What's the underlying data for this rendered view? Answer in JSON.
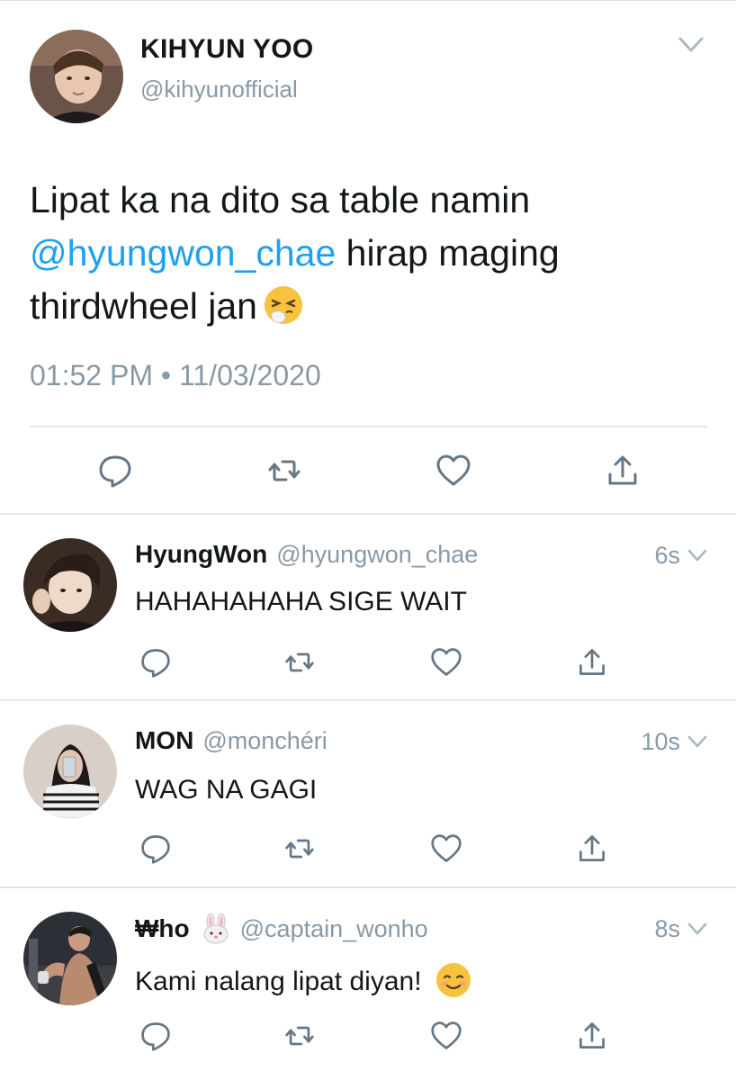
{
  "main_tweet": {
    "name": "KIHYUN YOO",
    "handle": "@kihyunofficial",
    "text_line1": "Lipat ka na dito sa table namin",
    "mention": "@hyungwon_chae",
    "text_line2_rest": " hirap maging",
    "text_line3": "thirdwheel jan",
    "timestamp": "01:52 PM • 11/03/2020",
    "emoji": "sneezing-face-emoji"
  },
  "replies": [
    {
      "name": "HyungWon",
      "handle": "@hyungwon_chae",
      "time": "6s",
      "text": "HAHAHAHAHA SIGE WAIT"
    },
    {
      "name": "MON",
      "handle": "@monchéri",
      "time": "10s",
      "text": "WAG NA GAGI"
    },
    {
      "name": "₩ho",
      "handle": "@captain_wonho",
      "time": "8s",
      "text": "Kami nalang lipat diyan!",
      "name_emoji": "rabbit-face-emoji",
      "text_emoji": "smiling-face-emoji"
    }
  ],
  "icons": {
    "reply": "reply-icon",
    "retweet": "retweet-icon",
    "like": "heart-icon",
    "share": "share-icon",
    "menu": "chevron-down-icon"
  },
  "colors": {
    "link": "#1da1f2",
    "secondary_text": "#8899a6",
    "icon": "#657786",
    "divider": "#e1e8ed"
  }
}
